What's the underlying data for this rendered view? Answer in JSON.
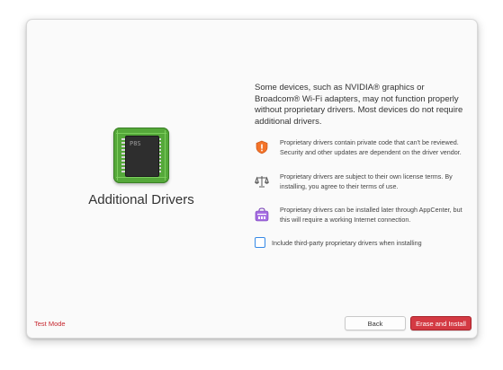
{
  "app": {
    "title": "Additional Drivers",
    "icon": "circuit-chip-icon",
    "chip_label": "P8S"
  },
  "intro_text": "Some devices, such as NVIDIA® graphics or Broadcom® Wi-Fi adapters, may not function properly without proprietary drivers. Most devices do not require additional drivers.",
  "info": [
    {
      "icon": "shield-warning-icon",
      "text": "Proprietary drivers contain private code that can't be reviewed. Security and other updates are dependent on the driver vendor."
    },
    {
      "icon": "scales-icon",
      "text": "Proprietary drivers are subject to their own license terms. By installing, you agree to their terms of use."
    },
    {
      "icon": "appcenter-icon",
      "text": "Proprietary drivers can be installed later through AppCenter, but this will require a working Internet connection."
    }
  ],
  "checkbox": {
    "label": "Include third-party proprietary drivers when installing",
    "checked": false
  },
  "footer": {
    "test_mode": "Test Mode",
    "back_label": "Back",
    "install_label": "Erase and Install"
  },
  "colors": {
    "accent_red": "#c6262e",
    "warning_orange": "#f37329",
    "appcenter_purple": "#a56de2",
    "checkbox_blue": "#3689e6",
    "chip_green": "#55a83a"
  }
}
